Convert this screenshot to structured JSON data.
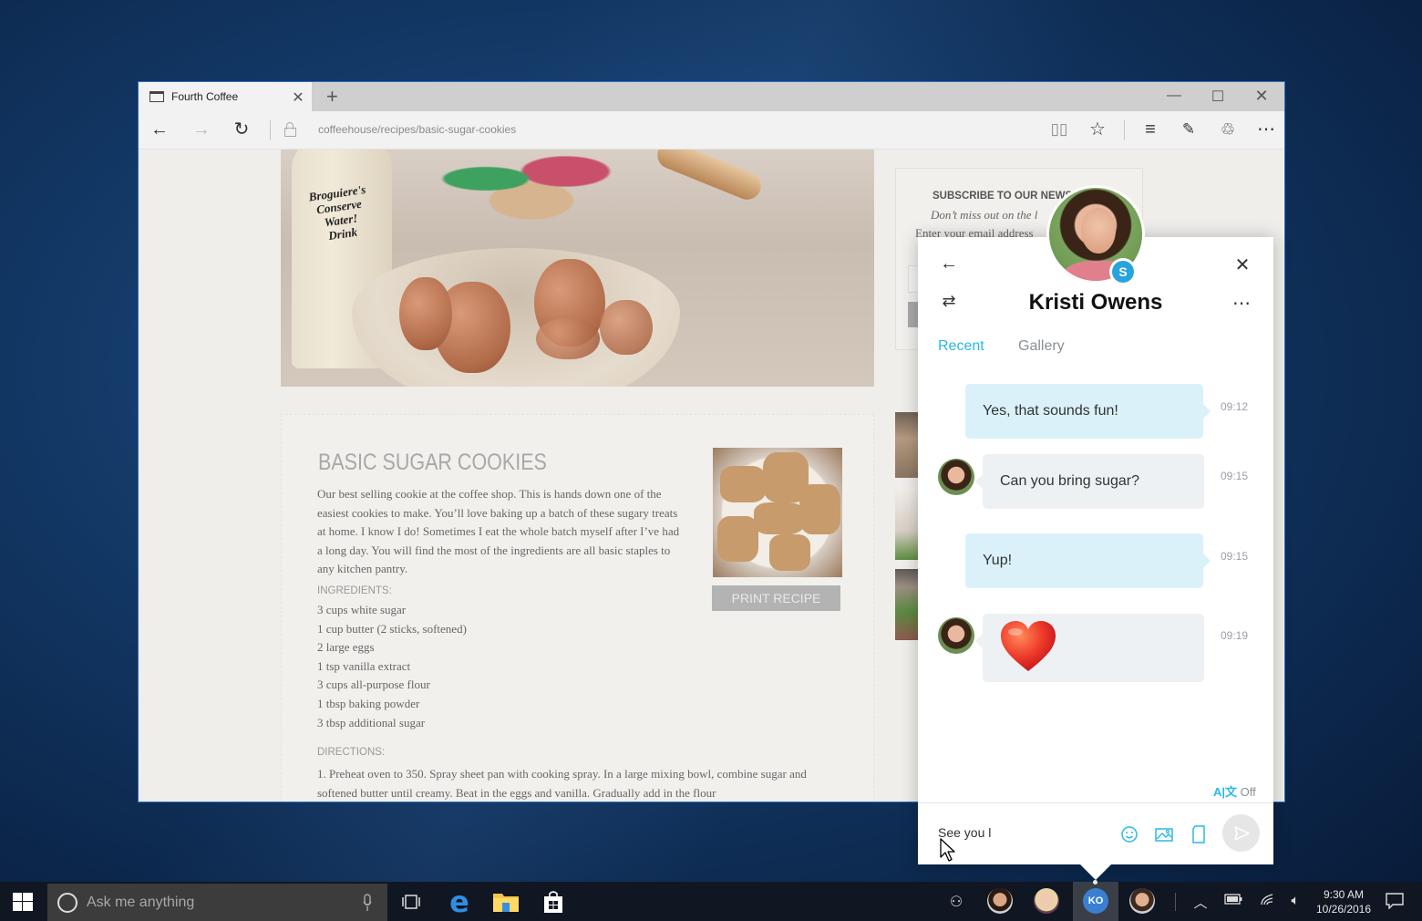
{
  "browser": {
    "tab_title": "Fourth Coffee",
    "address": "coffeehouse/recipes/basic-sugar-cookies",
    "icons": [
      "tab-page-icon",
      "close-icon",
      "plus-icon",
      "minimize-icon",
      "maximize-icon",
      "close-window-icon",
      "back-arrow-icon",
      "forward-arrow-icon",
      "refresh-icon",
      "lock-icon",
      "reading-view-icon",
      "star-icon",
      "hub-icon",
      "web-note-icon",
      "share-icon",
      "more-icon"
    ]
  },
  "hero": {
    "milk_label": "Broguiere's Conserve Water! Drink"
  },
  "recipe": {
    "title": "BASIC SUGAR COOKIES",
    "intro": "Our best selling cookie at the coffee shop. This is hands down one of the easiest cookies to make. You’ll love baking up a batch of these sugary treats at home. I know I do! Sometimes I eat the whole batch myself after I’ve had a long day. You will find the most of the ingredients are all basic staples to any kitchen pantry.",
    "ingredients_label": "INGREDIENTS:",
    "ingredients": [
      "3 cups white sugar",
      "1 cup butter (2 sticks, softened)",
      "2 large eggs",
      "1 tsp vanilla extract",
      "3 cups all-purpose flour",
      "1 tbsp baking powder",
      "3 tbsp additional sugar"
    ],
    "directions_label": "DIRECTIONS:",
    "directions": "1.  Preheat oven to 350. Spray sheet pan with cooking spray. In a large mixing bowl, combine sugar and softened butter until creamy. Beat in the eggs and vanilla. Gradually add in the flour",
    "print_button": "PRINT RECIPE"
  },
  "newsletter": {
    "title": "SUBSCRIBE TO OUR NEWS",
    "subtitle": "Don’t miss out on the l",
    "email_prompt": "Enter your email address"
  },
  "chat": {
    "contact_name": "Kristi Owens",
    "presence_badge": "S",
    "tabs": [
      {
        "label": "Recent",
        "active": true
      },
      {
        "label": "Gallery",
        "active": false
      }
    ],
    "messages": [
      {
        "direction": "out",
        "text": "Yes, that sounds fun!",
        "time": "09:12"
      },
      {
        "direction": "in",
        "text": "Can you bring sugar?",
        "time": "09:15"
      },
      {
        "direction": "out",
        "text": "Yup!",
        "time": "09:15"
      },
      {
        "direction": "in",
        "text": "",
        "emoji": "heart",
        "time": "09:19"
      }
    ],
    "translate_label": "Off",
    "compose_value": "See you l",
    "compose_icons": [
      "emoji-icon",
      "image-icon",
      "file-icon",
      "send-icon"
    ],
    "accent": "#29b8e5",
    "out_bubble_color": "#daf1fa",
    "in_bubble_color": "#eef1f4"
  },
  "taskbar": {
    "search_placeholder": "Ask me anything",
    "apps": [
      "task-view",
      "edge",
      "file-explorer",
      "store"
    ],
    "people": [
      {
        "name": "contact-1"
      },
      {
        "name": "contact-2"
      },
      {
        "name": "Kristi Owens",
        "initials": "KO",
        "active": true
      },
      {
        "name": "contact-4"
      }
    ],
    "time": "9:30 AM",
    "date": "10/26/2016"
  }
}
